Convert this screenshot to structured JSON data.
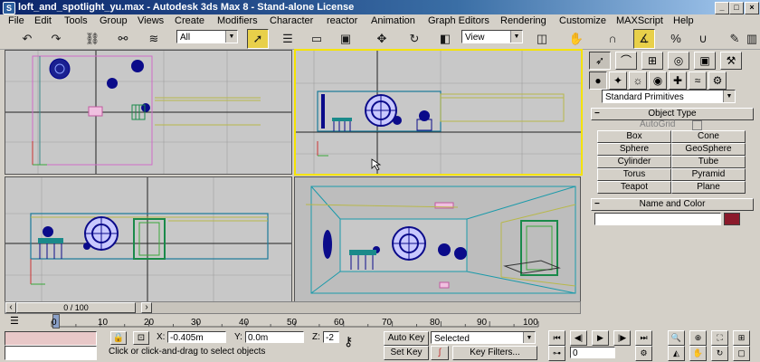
{
  "window": {
    "icon_glyph": "S",
    "title": "loft_and_spotlight_yu.max - Autodesk 3ds Max 8 - Stand-alone License",
    "buttons": [
      "_",
      "□",
      "×"
    ]
  },
  "menu": [
    "File",
    "Edit",
    "Tools",
    "Group",
    "Views",
    "Create",
    "Modifiers",
    "Character",
    "reactor",
    "Animation",
    "Graph Editors",
    "Rendering",
    "Customize",
    "MAXScript",
    "Help"
  ],
  "toolbar": {
    "selection_filter": "All",
    "reference_coord": "View"
  },
  "command_panel": {
    "tabs": [
      "create-tab",
      "modify-tab",
      "hierarchy-tab",
      "motion-tab",
      "display-tab",
      "utilities-tab"
    ],
    "category_icons": [
      "geometry-icon",
      "shapes-icon",
      "lights-icon",
      "cameras-icon",
      "helpers-icon",
      "spacewarps-icon",
      "systems-icon"
    ],
    "dropdown": "Standard Primitives",
    "object_type": {
      "title": "Object Type",
      "autogrid_label": "AutoGrid",
      "buttons": [
        "Box",
        "Cone",
        "Sphere",
        "GeoSphere",
        "Cylinder",
        "Tube",
        "Torus",
        "Pyramid",
        "Teapot",
        "Plane"
      ]
    },
    "name_and_color": {
      "title": "Name and Color",
      "name_value": "",
      "color": "#8b1a2b"
    }
  },
  "timeline": {
    "slider_label": "0 / 100",
    "ticks": [
      "0",
      "10",
      "20",
      "30",
      "40",
      "50",
      "60",
      "70",
      "80",
      "90",
      "100"
    ]
  },
  "status": {
    "x_label": "X:",
    "x_value": "-0.405m",
    "y_label": "Y:",
    "y_value": "0.0m",
    "z_label": "Z:",
    "z_value": "-2",
    "prompt": "Click or click-and-drag to select objects",
    "auto_key": "Auto Key",
    "set_key": "Set Key",
    "selected": "Selected",
    "key_filters": "Key Filters...",
    "frame": "0"
  },
  "colors": {
    "active_viewport": "#f5e300",
    "title_start": "#0a246a",
    "title_end": "#a6caf0"
  }
}
